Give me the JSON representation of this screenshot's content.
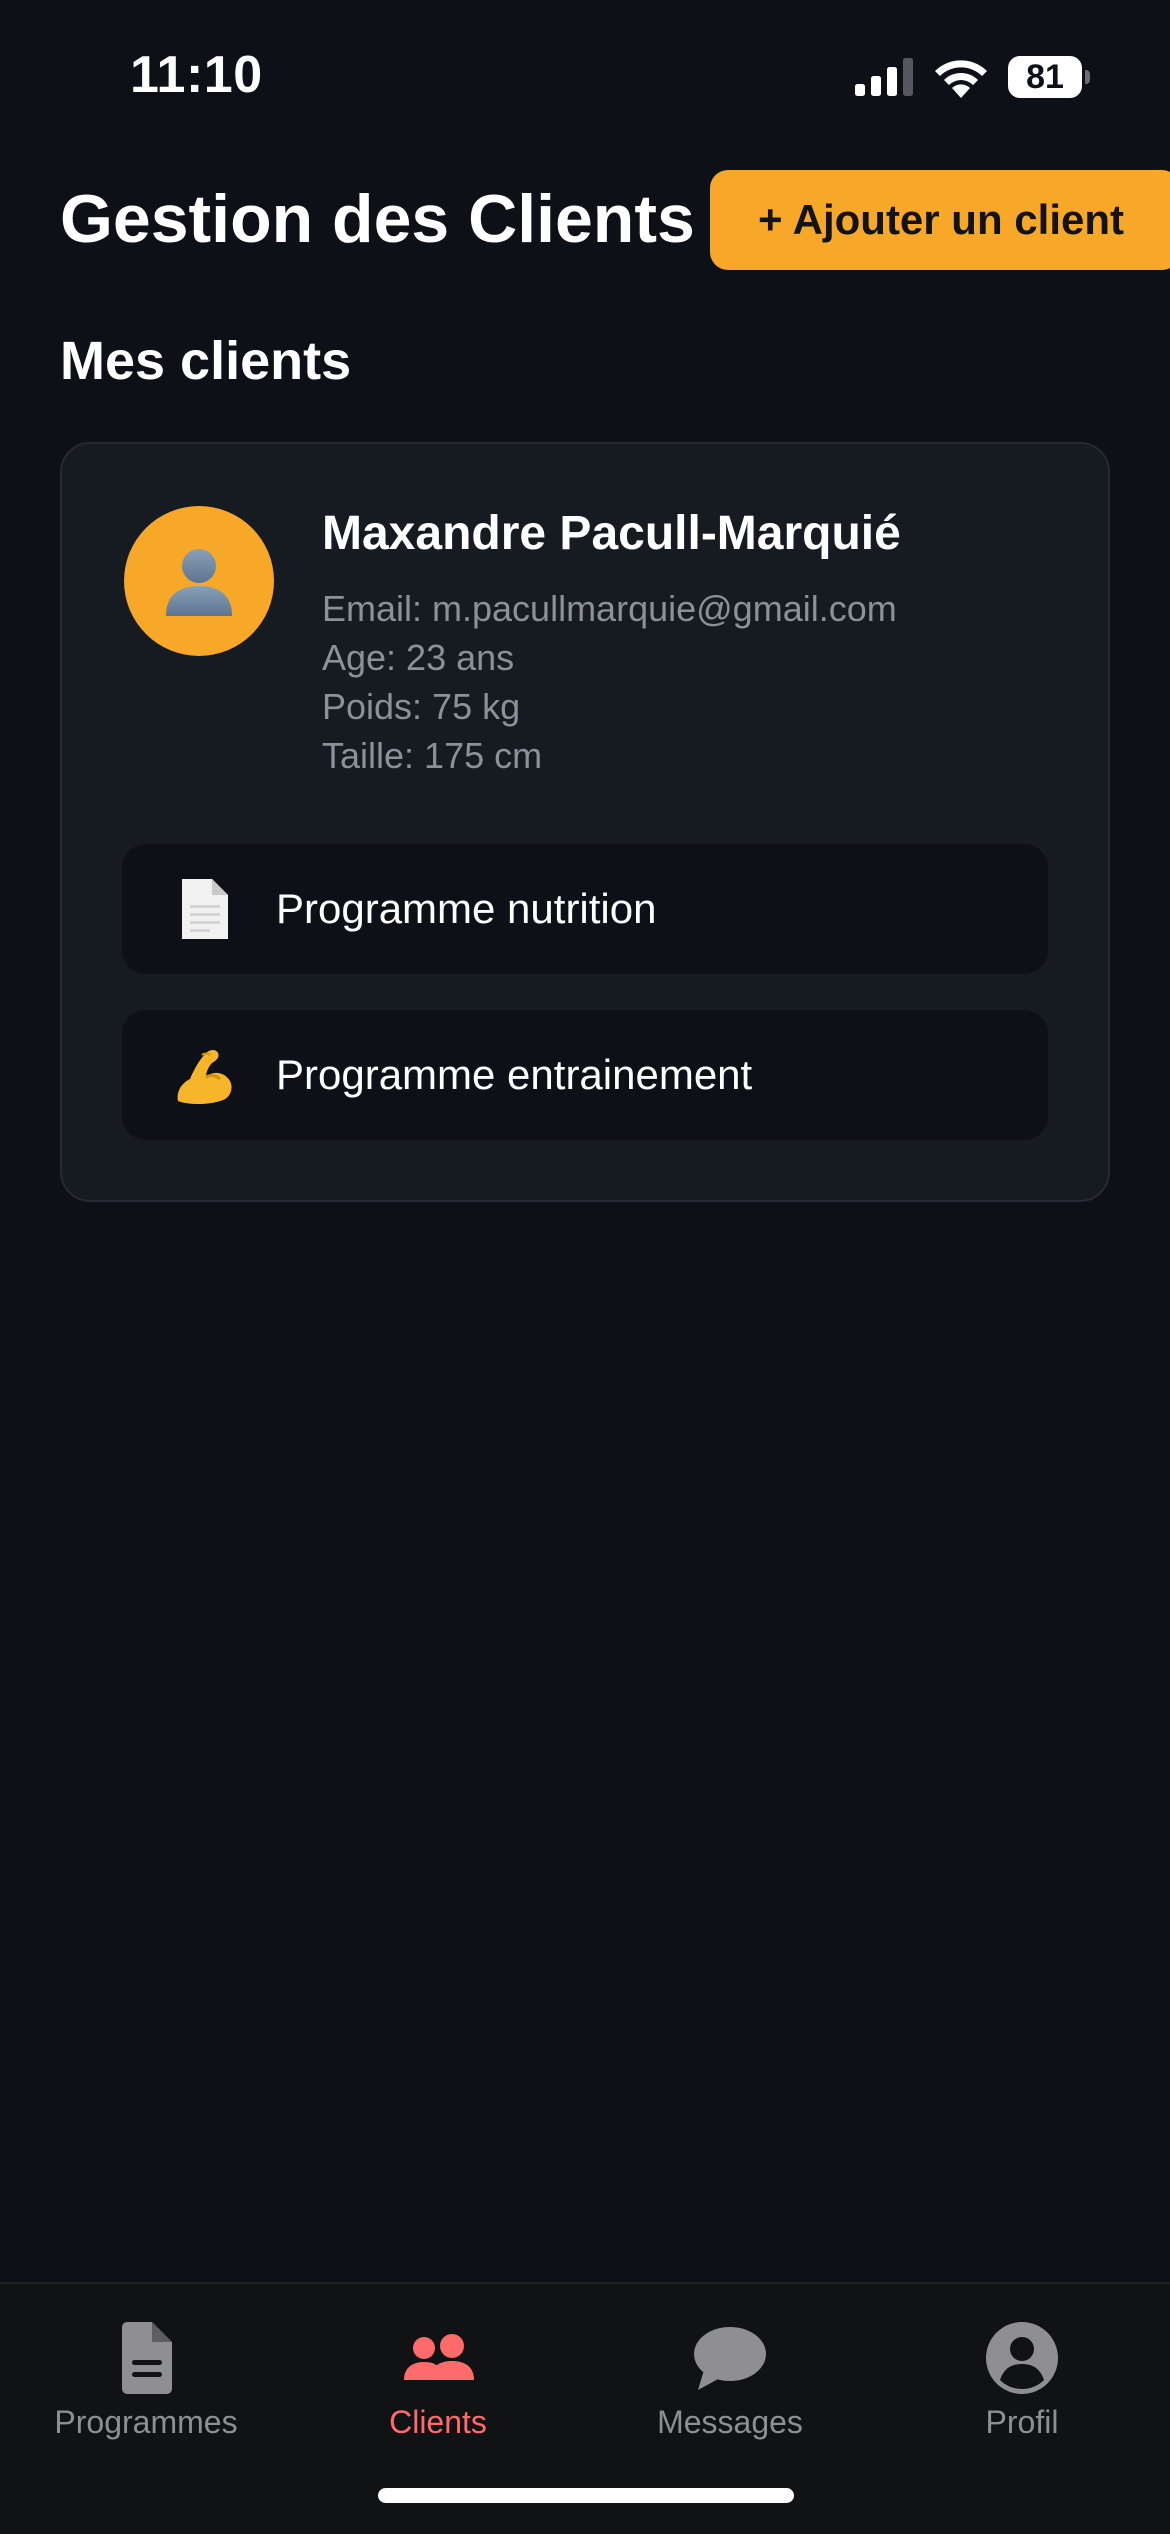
{
  "status_bar": {
    "time": "11:10",
    "battery": "81",
    "icons": [
      "signal-icon",
      "wifi-icon",
      "battery-icon"
    ]
  },
  "header": {
    "title": "Gestion des Clients",
    "add_button_label": "+ Ajouter un client"
  },
  "section": {
    "title": "Mes clients"
  },
  "client": {
    "avatar_icon": "person-silhouette-icon",
    "name": "Maxandre Pacull-Marquié",
    "email": "Email: m.pacullmarquie@gmail.com",
    "age": "Age: 23 ans",
    "weight": "Poids: 75 kg",
    "height": "Taille: 175 cm",
    "actions": [
      {
        "icon": "document-icon",
        "label": "Programme nutrition"
      },
      {
        "icon": "flexed-biceps-icon",
        "label": "Programme entrainement"
      }
    ]
  },
  "tab_bar": {
    "active": "Clients",
    "tabs": [
      {
        "icon": "document-icon",
        "label": "Programmes"
      },
      {
        "icon": "people-icon",
        "label": "Clients"
      },
      {
        "icon": "chat-bubble-icon",
        "label": "Messages"
      },
      {
        "icon": "user-circle-icon",
        "label": "Profil"
      }
    ]
  },
  "colors": {
    "background": "#0d1017",
    "card": "#161a21",
    "accent": "#f7a829",
    "active_tab": "#ff6b6b",
    "inactive_tab": "#8e8e93",
    "secondary_text": "#8c9099"
  }
}
